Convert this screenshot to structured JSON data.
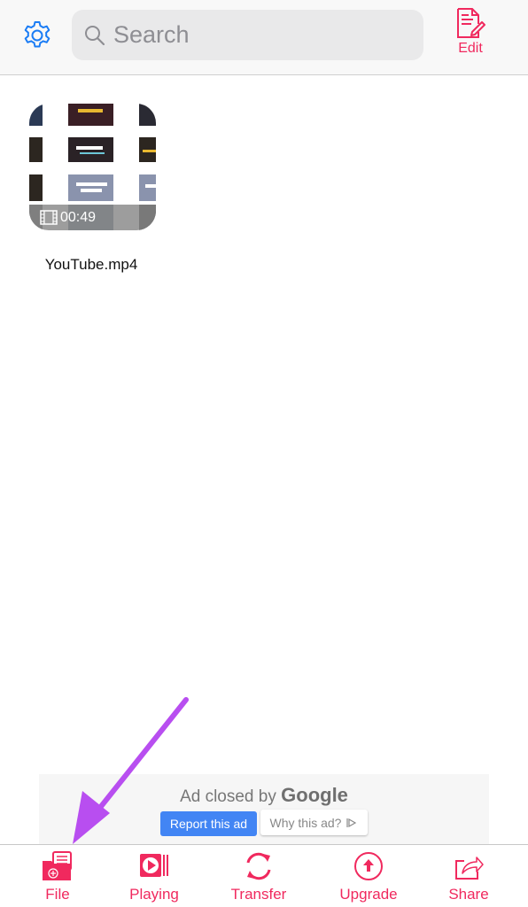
{
  "header": {
    "settings_icon": "gear-icon",
    "search_placeholder": "Search",
    "search_value": "",
    "edit_label": "Edit",
    "edit_icon": "document-edit-icon"
  },
  "files": [
    {
      "name": "YouTube.mp4",
      "duration": "00:49",
      "type_icon": "film-icon"
    }
  ],
  "ad": {
    "closed_text": "Ad closed by",
    "brand": "Google",
    "report_label": "Report this ad",
    "why_label": "Why this ad?",
    "why_icon": "adchoices-icon"
  },
  "tabbar": {
    "items": [
      {
        "label": "File",
        "icon": "folder-add-icon"
      },
      {
        "label": "Playing",
        "icon": "play-icon"
      },
      {
        "label": "Transfer",
        "icon": "sync-icon"
      },
      {
        "label": "Upgrade",
        "icon": "upload-circle-icon"
      },
      {
        "label": "Share",
        "icon": "share-icon"
      }
    ]
  },
  "colors": {
    "accent": "#f0295e",
    "settings_blue": "#1a7cf5",
    "ad_button_blue": "#4285f4",
    "annotation_arrow": "#b84ef0"
  }
}
